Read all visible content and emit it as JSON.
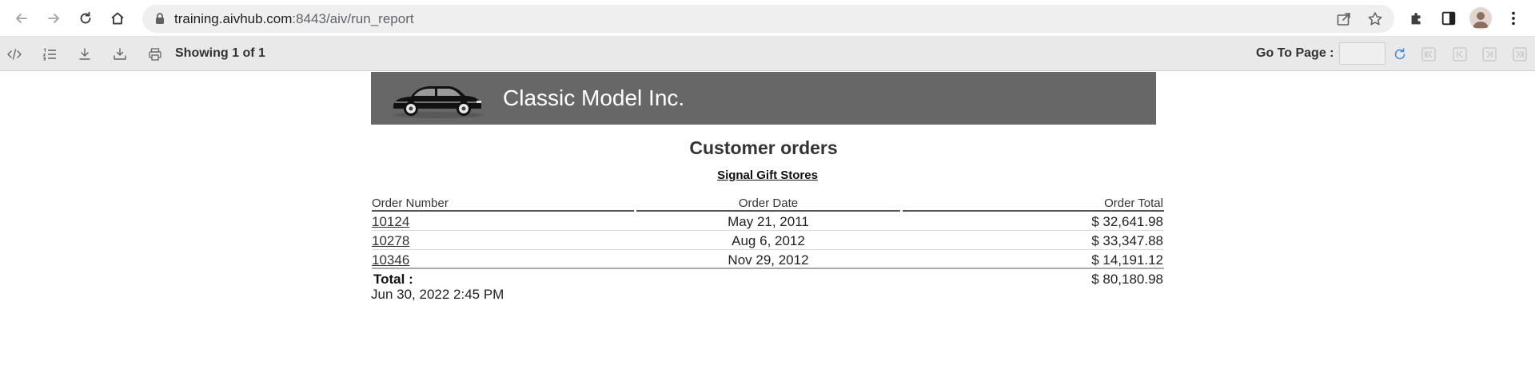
{
  "browser": {
    "url_host": "training.aivhub.com",
    "url_rest": ":8443/aiv/run_report"
  },
  "toolbar": {
    "showing_text": "Showing 1 of 1",
    "goto_label": "Go To Page :",
    "goto_value": ""
  },
  "report": {
    "company_name": "Classic Model Inc.",
    "title": "Customer orders",
    "customer_name": "Signal Gift Stores",
    "columns": {
      "order_number": "Order Number",
      "order_date": "Order Date",
      "order_total": "Order Total"
    },
    "rows": [
      {
        "order_number": "10124",
        "order_date": "May 21, 2011",
        "order_total": "$ 32,641.98"
      },
      {
        "order_number": "10278",
        "order_date": "Aug 6, 2012",
        "order_total": "$ 33,347.88"
      },
      {
        "order_number": "10346",
        "order_date": "Nov 29, 2012",
        "order_total": "$ 14,191.12"
      }
    ],
    "total_label": "Total :",
    "total_value": "$ 80,180.98",
    "generated_at": "Jun 30, 2022 2:45 PM"
  },
  "colors": {
    "banner": "#676767",
    "toolbar": "#e9e9e9",
    "refresh_accent": "#4a8fd9"
  }
}
